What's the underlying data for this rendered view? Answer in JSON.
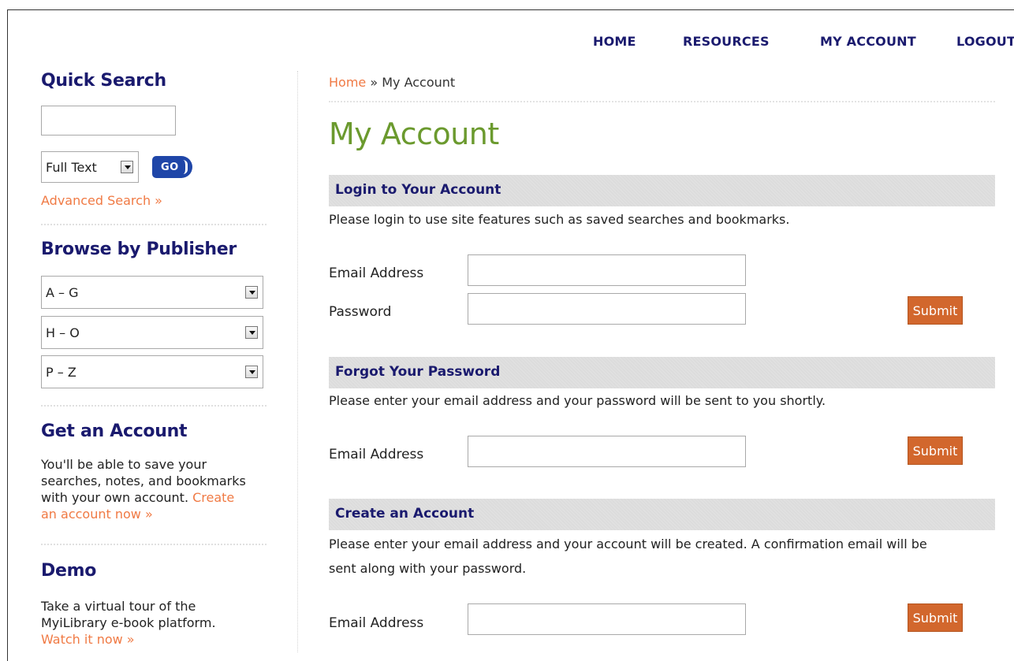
{
  "nav": {
    "home": "HOME",
    "resources": "RESOURCES",
    "my_account": "MY ACCOUNT",
    "logout": "LOGOUT"
  },
  "sidebar": {
    "quick_search": {
      "title": "Quick Search",
      "input_value": "",
      "select_value": "Full Text",
      "go_label": "GO",
      "advanced_link": "Advanced Search »"
    },
    "browse": {
      "title": "Browse by Publisher",
      "selects": [
        "A – G",
        "H – O",
        "P – Z"
      ]
    },
    "get_account": {
      "title": "Get an Account",
      "line1": "You'll be able to save your",
      "line2": "searches, notes, and bookmarks",
      "line3_text": "with your own account. ",
      "line3_link": "Create",
      "line4_link": "an account now »"
    },
    "demo": {
      "title": "Demo",
      "line1": "Take a virtual tour of the",
      "line2": "MyiLibrary e-book platform.",
      "link": "Watch it now »"
    }
  },
  "breadcrumb": {
    "home": "Home",
    "separator": " » ",
    "current": "My Account"
  },
  "main": {
    "title": "My Account",
    "login": {
      "title": "Login to Your Account",
      "description": "Please login to use site features such as saved searches and bookmarks.",
      "email_label": "Email Address",
      "password_label": "Password",
      "email_value": "",
      "password_value": "",
      "submit": "Submit"
    },
    "forgot": {
      "title": "Forgot Your Password",
      "description": "Please enter your email address and your password will be sent to you shortly.",
      "email_label": "Email Address",
      "email_value": "",
      "submit": "Submit"
    },
    "create": {
      "title": "Create an Account",
      "description_line1": "Please enter your email address and your account will be created. A confirmation email will be",
      "description_line2": "sent along with your password.",
      "email_label": "Email Address",
      "email_value": "",
      "submit": "Submit"
    }
  },
  "colors": {
    "nav_text": "#1a1a6e",
    "link_orange": "#f07a44",
    "title_green": "#6b9a2e",
    "button_orange": "#d2672d",
    "go_blue": "#1f46a8",
    "section_bar": "#dcdcdc"
  }
}
